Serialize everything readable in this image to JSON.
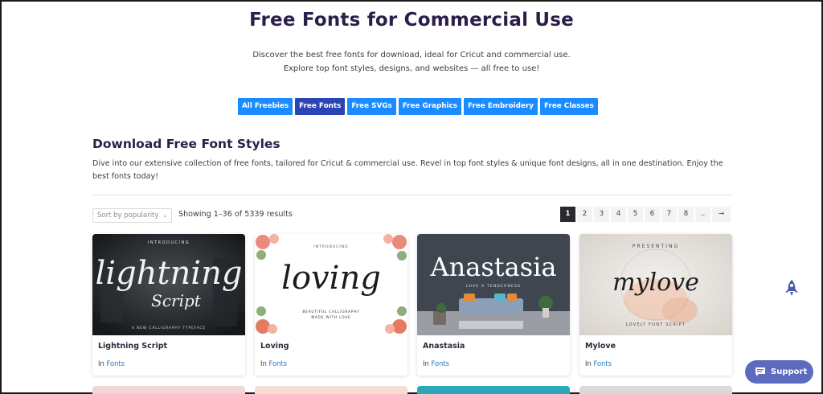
{
  "header": {
    "title": "Free Fonts for Commercial Use",
    "intro_line1": "Discover the best free fonts for download, ideal for Cricut and commercial use.",
    "intro_line2": "Explore top font styles, designs, and websites — all free to use!"
  },
  "categories": [
    {
      "label": "All Freebies",
      "active": false
    },
    {
      "label": "Free Fonts",
      "active": true
    },
    {
      "label": "Free SVGs",
      "active": false
    },
    {
      "label": "Free Graphics",
      "active": false
    },
    {
      "label": "Free Embroidery",
      "active": false
    },
    {
      "label": "Free Classes",
      "active": false
    }
  ],
  "section": {
    "title": "Download Free Font Styles",
    "description": "Dive into our extensive collection of free fonts, tailored for Cricut & commercial use. Revel in top font styles & unique font designs, all in one destination. Enjoy the best fonts today!"
  },
  "toolbar": {
    "sort_value": "Sort by popularity",
    "results_text": "Showing 1–36 of 5339 results"
  },
  "pagination": {
    "pages": [
      "1",
      "2",
      "3",
      "4",
      "5",
      "6",
      "7",
      "8",
      "..",
      "→"
    ],
    "current": "1"
  },
  "products": [
    {
      "name": "Lightning Script",
      "in": "In",
      "category": "Fonts",
      "thumb": {
        "top": "INTRODUCING",
        "main": "lightning",
        "sub": "Script",
        "bottom": "A NEW CALLIGRAPHY TYPEFACE"
      }
    },
    {
      "name": "Loving",
      "in": "In",
      "category": "Fonts",
      "thumb": {
        "top": "INTRODUCING",
        "main": "loving",
        "bottom": "BEAUTIFUL CALLIGRAPHY",
        "bottom2": "MADE WITH LOVE"
      }
    },
    {
      "name": "Anastasia",
      "in": "In",
      "category": "Fonts",
      "thumb": {
        "main": "Anastasia",
        "sub": "LOVE A TENDERNESS"
      }
    },
    {
      "name": "Mylove",
      "in": "In",
      "category": "Fonts",
      "thumb": {
        "top": "PRESENTING",
        "main": "mylove",
        "bottom": "LOVELY FONT SCRIPT"
      }
    }
  ],
  "support": {
    "label": "Support"
  },
  "colors": {
    "accent": "#1a8cff",
    "accent_active": "#2b44b5",
    "title": "#2b1f4a",
    "link": "#2079c6",
    "support": "#5c6bc0"
  },
  "icons": [
    "rocket-icon",
    "chat-icon",
    "chevron-down-icon"
  ]
}
